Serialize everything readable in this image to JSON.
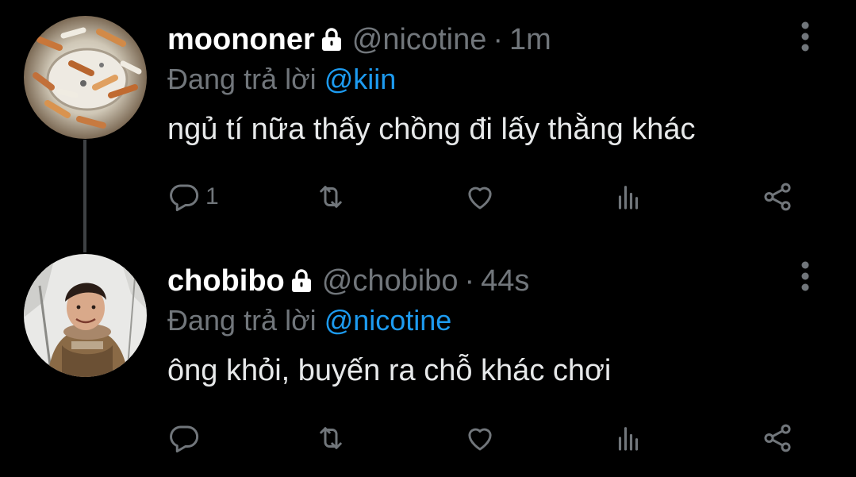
{
  "tweets": [
    {
      "display_name": "moononer",
      "handle": "@nicotine",
      "separator": "·",
      "time": "1m",
      "reply_prefix": "Đang trả lời",
      "reply_to": "@kiin",
      "text": "ngủ tí nữa thấy chồng đi lấy thằng khác",
      "reply_count": "1",
      "avatar_icon": "avatar-cigarettes-photo"
    },
    {
      "display_name": "chobibo",
      "handle": "@chobibo",
      "separator": "·",
      "time": "44s",
      "reply_prefix": "Đang trả lời",
      "reply_to": "@nicotine",
      "text": "ông khỏi, buyến ra chỗ khác chơi",
      "reply_count": "",
      "avatar_icon": "avatar-person-photo"
    }
  ],
  "colors": {
    "background": "#000000",
    "text": "#e7e9ea",
    "muted": "#71767b",
    "link": "#1d9bf0",
    "thread_line": "#3e4144"
  },
  "icons": [
    "lock-icon",
    "more-icon",
    "reply-icon",
    "retweet-icon",
    "like-icon",
    "views-icon",
    "share-icon"
  ]
}
